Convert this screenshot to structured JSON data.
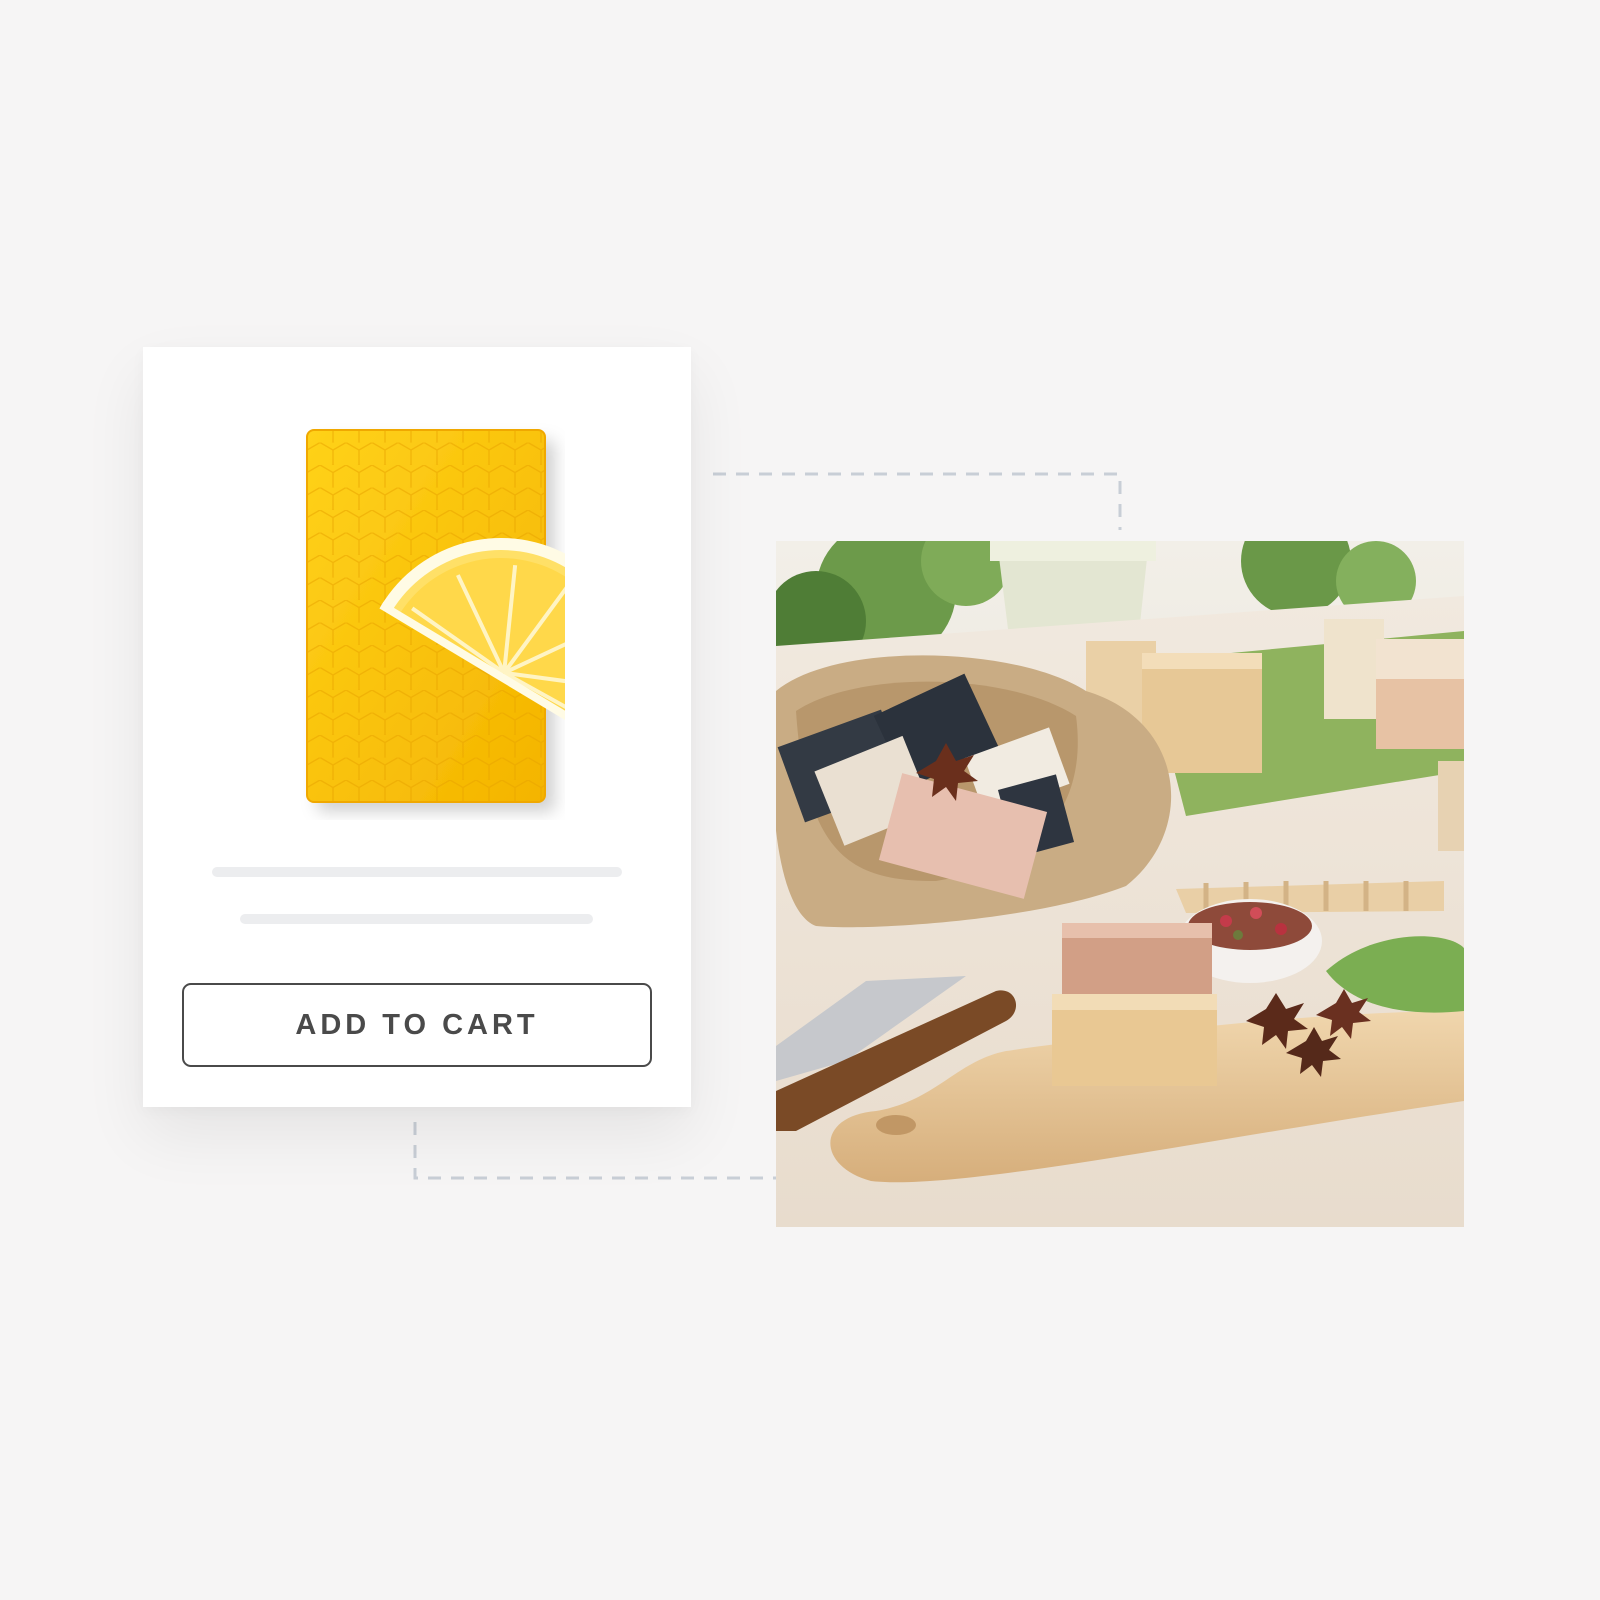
{
  "product_card": {
    "image_icon": "lemon-honeycomb-soap-image",
    "cart_button_label": "ADD TO CART"
  },
  "lifestyle_image": {
    "icon": "handmade-soap-photo"
  },
  "colors": {
    "background": "#f6f5f5",
    "card": "#ffffff",
    "button_border": "#4a4a4a",
    "placeholder_line": "#ecedef",
    "connector": "#c8ced6"
  }
}
